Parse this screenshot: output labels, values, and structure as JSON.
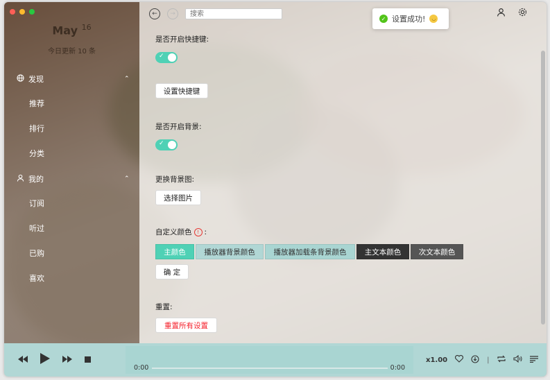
{
  "sidebar": {
    "date_month": "May",
    "date_day": "16",
    "update_text": "今日更新 10 条",
    "discover": {
      "label": "发现",
      "items": [
        "推荐",
        "排行",
        "分类"
      ]
    },
    "mine": {
      "label": "我的",
      "items": [
        "订阅",
        "听过",
        "已购",
        "喜欢"
      ]
    }
  },
  "header": {
    "search_placeholder": "搜索",
    "toast_text": "设置成功!"
  },
  "settings": {
    "shortcut_label": "是否开启快捷键:",
    "set_shortcut_button": "设置快捷键",
    "background_label": "是否开启背景:",
    "change_bg_label": "更换背景图:",
    "choose_image_button": "选择图片",
    "custom_color_label": "自定义颜色",
    "custom_color_suffix": ":",
    "color_buttons": [
      {
        "label": "主颜色",
        "bg": "#4fd1b5",
        "fg": "#ffffff"
      },
      {
        "label": "播放器背景颜色",
        "bg": "#b1d7d5",
        "fg": "#333333"
      },
      {
        "label": "播放器加载条背景颜色",
        "bg": "#a9d5d2",
        "fg": "#333333"
      },
      {
        "label": "主文本颜色",
        "bg": "#333333",
        "fg": "#ffffff"
      },
      {
        "label": "次文本颜色",
        "bg": "#555555",
        "fg": "#ffffff"
      }
    ],
    "confirm_button": "确 定",
    "reset_label": "重置:",
    "reset_button": "重置所有设置"
  },
  "player": {
    "time_current": "0:00",
    "time_total": "0:00",
    "speed": "x1.00"
  },
  "colors": {
    "accent": "#4fd1b5",
    "danger": "#f5222d",
    "player_bg": "#b1d7d5"
  }
}
